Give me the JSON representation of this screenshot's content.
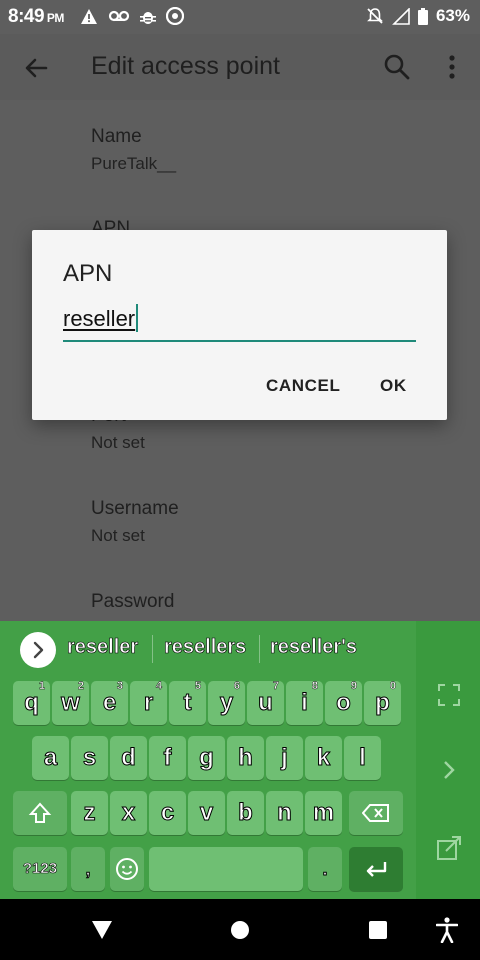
{
  "status_bar": {
    "time": "8:49",
    "ampm": "PM",
    "battery": "63%"
  },
  "app_bar": {
    "title": "Edit access point"
  },
  "prefs": [
    {
      "title": "Name",
      "summary": "PureTalk__"
    },
    {
      "title": "APN",
      "summary": ""
    },
    {
      "title": "Port",
      "summary": "Not set"
    },
    {
      "title": "Username",
      "summary": "Not set"
    },
    {
      "title": "Password",
      "summary": ""
    }
  ],
  "dialog": {
    "title": "APN",
    "value": "reseller",
    "cancel_label": "CANCEL",
    "ok_label": "OK"
  },
  "keyboard": {
    "suggestions": [
      "reseller",
      "resellers",
      "reseller's"
    ],
    "row1": [
      {
        "k": "q",
        "h": "1"
      },
      {
        "k": "w",
        "h": "2"
      },
      {
        "k": "e",
        "h": "3"
      },
      {
        "k": "r",
        "h": "4"
      },
      {
        "k": "t",
        "h": "5"
      },
      {
        "k": "y",
        "h": "6"
      },
      {
        "k": "u",
        "h": "7"
      },
      {
        "k": "i",
        "h": "8"
      },
      {
        "k": "o",
        "h": "9"
      },
      {
        "k": "p",
        "h": "0"
      }
    ],
    "row2": [
      "a",
      "s",
      "d",
      "f",
      "g",
      "h",
      "j",
      "k",
      "l"
    ],
    "row3": [
      "z",
      "x",
      "c",
      "v",
      "b",
      "n",
      "m"
    ],
    "symbols_label": "?123",
    "comma": ",",
    "period": ".",
    "accent_color": "#43a047"
  }
}
